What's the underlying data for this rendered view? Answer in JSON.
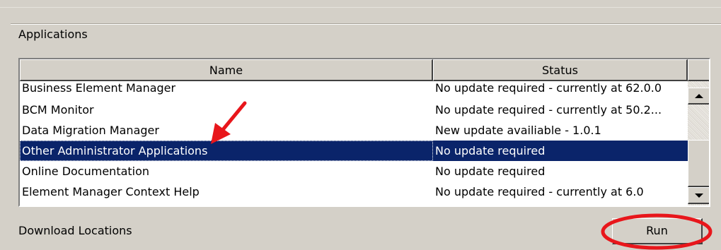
{
  "section": {
    "label": "Applications"
  },
  "table": {
    "columns": [
      "Name",
      "Status"
    ],
    "rows": [
      {
        "name": "Business Element Manager",
        "status": "No update required - currently at 62.0.0"
      },
      {
        "name": "BCM Monitor",
        "status": "No update required - currently at 50.2..."
      },
      {
        "name": "Data Migration Manager",
        "status": "New update availiable - 1.0.1"
      },
      {
        "name": "Other Administrator Applications",
        "status": "No update required",
        "selected": true
      },
      {
        "name": "Online Documentation",
        "status": "No update required"
      },
      {
        "name": "Element Manager Context Help",
        "status": "No update required - currently at 6.0"
      }
    ]
  },
  "footer": {
    "download_label": "Download Locations",
    "run_label": "Run"
  },
  "colors": {
    "selection": "#0a246a",
    "annotation": "#e8161b",
    "background": "#d4d0c8"
  },
  "icons": {
    "scroll_up": "arrow-up",
    "scroll_down": "arrow-down"
  }
}
